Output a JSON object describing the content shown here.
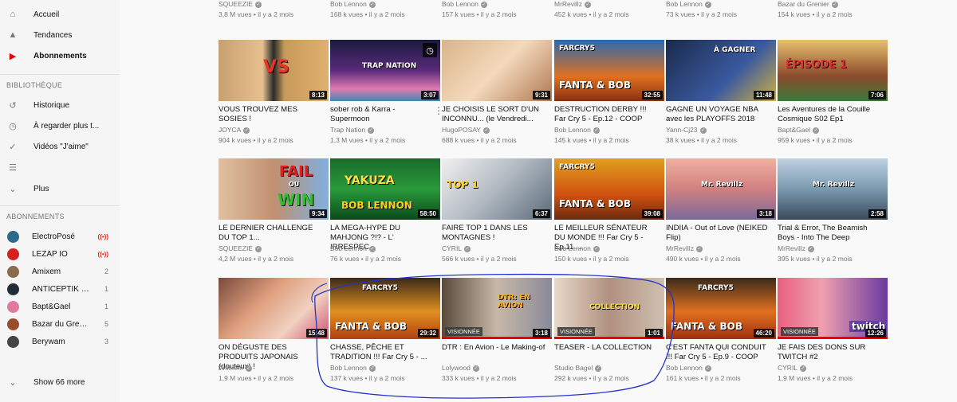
{
  "sidebar": {
    "nav": [
      {
        "label": "Accueil",
        "icon": "home-icon",
        "glyph": "⌂"
      },
      {
        "label": "Tendances",
        "icon": "flame-icon",
        "glyph": "▲"
      },
      {
        "label": "Abonnements",
        "icon": "subscriptions-icon",
        "glyph": "▶",
        "active": true
      }
    ],
    "library_heading": "BIBLIOTHÈQUE",
    "library": [
      {
        "label": "Historique",
        "icon": "history-icon",
        "glyph": "↺"
      },
      {
        "label": "À regarder plus t...",
        "icon": "watch-later-icon",
        "glyph": "◷"
      },
      {
        "label": "Vidéos \"J'aime\"",
        "icon": "thumbs-up-icon",
        "glyph": "✓"
      },
      {
        "label": "",
        "icon": "playlist-icon",
        "glyph": "☰"
      },
      {
        "label": "Plus",
        "icon": "chevron-down-icon",
        "glyph": "⌄"
      }
    ],
    "subs_heading": "ABONNEMENTS",
    "subs": [
      {
        "name": "ElectroPosé",
        "badge": "((•))",
        "live": true,
        "color": "#2b6a8a"
      },
      {
        "name": "LEZAP IO",
        "badge": "((•))",
        "live": true,
        "color": "#d61f1f"
      },
      {
        "name": "Amixem",
        "badge": "2",
        "color": "#8a6b4a"
      },
      {
        "name": "ANTICEPTIK KA...",
        "badge": "1",
        "color": "#222c3a"
      },
      {
        "name": "Bapt&Gael",
        "badge": "1",
        "color": "#e07aa0"
      },
      {
        "name": "Bazar du Grenier",
        "badge": "5",
        "color": "#9a4b2a"
      },
      {
        "name": "Berywam",
        "badge": "3",
        "color": "#444"
      }
    ],
    "show_more": "Show 66 more"
  },
  "top_row": [
    {
      "channel": "SQUEEZIE",
      "meta": "3,8 M vues • il y a 2 mois"
    },
    {
      "channel": "Bob Lennon",
      "meta": "168 k vues • il y a 2 mois"
    },
    {
      "channel": "Bob Lennon",
      "meta": "157 k vues • il y a 2 mois"
    },
    {
      "channel": "MrRevillz",
      "meta": "452 k vues • il y a 2 mois"
    },
    {
      "channel": "Bob Lennon",
      "meta": "73 k vues • il y a 2 mois"
    },
    {
      "channel": "Bazar du Grenier",
      "meta": "154 k vues • il y a 2 mois"
    }
  ],
  "rows": [
    [
      {
        "title": "VOUS TROUVEZ MES SOSIES !",
        "channel": "JOYCA",
        "meta": "904 k vues • il y a 2 mois",
        "duration": "8:13"
      },
      {
        "title": "sober rob & Karra - Supermoon",
        "channel": "Trap Nation",
        "meta": "1,3 M vues • il y a 2 mois",
        "duration": "3:07",
        "menu": true,
        "clock": true
      },
      {
        "title": "JE CHOISIS LE SORT D'UN INCONNU... (le Vendredi...",
        "channel": "HugoPOSAY",
        "meta": "688 k vues • il y a 2 mois",
        "duration": "9:31"
      },
      {
        "title": "DESTRUCTION DERBY !!! Far Cry 5 - Ep.12 - COOP",
        "channel": "Bob Lennon",
        "meta": "145 k vues • il y a 2 mois",
        "duration": "32:55"
      },
      {
        "title": "GAGNE UN VOYAGE NBA avec les PLAYOFFS 2018",
        "channel": "Yann-Cj23",
        "meta": "38 k vues • il y a 2 mois",
        "duration": "11:48"
      },
      {
        "title": "Les Aventures de la Couille Cosmique S02 Ep1",
        "channel": "Bapt&Gael",
        "meta": "959 k vues • il y a 2 mois",
        "duration": "7:06"
      }
    ],
    [
      {
        "title": "LE DERNIER CHALLENGE DU TOP 1...",
        "channel": "SQUEEZIE",
        "meta": "4,2 M vues • il y a 2 mois",
        "duration": "9:34"
      },
      {
        "title": "LA MEGA-HYPE DU MAHJONG ?!? - L' IRRESPEC...",
        "channel": "Bob Lennon",
        "meta": "76 k vues • il y a 2 mois",
        "duration": "58:50"
      },
      {
        "title": "FAIRE TOP 1 DANS LES MONTAGNES !",
        "channel": "CYRIL",
        "meta": "566 k vues • il y a 2 mois",
        "duration": "6:37"
      },
      {
        "title": "LE MEILLEUR SÉNATEUR DU MONDE !!! Far Cry 5 - Ep.11 ...",
        "channel": "Bob Lennon",
        "meta": "150 k vues • il y a 2 mois",
        "duration": "39:08"
      },
      {
        "title": "INDIIA - Out of Love (NEIKED Flip)",
        "channel": "MrRevillz",
        "meta": "490 k vues • il y a 2 mois",
        "duration": "3:18"
      },
      {
        "title": "Trial & Error, The Beamish Boys - Into The Deep",
        "channel": "MrRevillz",
        "meta": "395 k vues • il y a 2 mois",
        "duration": "2:58"
      }
    ],
    [
      {
        "title": "ON DÉGUSTE DES PRODUITS JAPONAIS (douteux) !",
        "channel": "Amixem",
        "meta": "1,9 M vues • il y a 2 mois",
        "duration": "15:48"
      },
      {
        "title": "CHASSE, PÊCHE ET TRADITION !!! Far Cry 5 - ...",
        "channel": "Bob Lennon",
        "meta": "137 k vues • il y a 2 mois",
        "duration": "29:32"
      },
      {
        "title": "DTR : En Avion - Le Making-of",
        "channel": "Lolywood",
        "meta": "333 k vues • il y a 2 mois",
        "duration": "3:18",
        "watched": "VISIONNÉE"
      },
      {
        "title": "TEASER - LA COLLECTION",
        "channel": "Studio Bagel",
        "meta": "292 k vues • il y a 2 mois",
        "duration": "1:01",
        "watched": "VISIONNÉE"
      },
      {
        "title": "C'EST FANTA QUI CONDUIT !!! Far Cry 5 - Ep.9 - COOP",
        "channel": "Bob Lennon",
        "meta": "161 k vues • il y a 2 mois",
        "duration": "46:20"
      },
      {
        "title": "JE FAIS DES DONS SUR TWITCH #2",
        "channel": "CYRIL",
        "meta": "1,9 M vues • il y a 2 mois",
        "duration": "12:26",
        "watched": "VISIONNÉE"
      }
    ]
  ],
  "thumb_text": {
    "vs": "VS",
    "trap": "TRAP NATION",
    "farcry": "FARCRY5",
    "fanta": "FANTA & BOB",
    "fail": "FAIL",
    "ou": "OU",
    "win": "WIN",
    "top1": "TOP 1",
    "yakuza": "YAKUZA",
    "boblennon": "BOB LENNON",
    "episode": "ÉPISODE 1",
    "gagner": "À GAGNER",
    "dtr": "DTR: EN AVION",
    "collection": "COLLECTION",
    "twitch": "twitch",
    "revillz": "Mr. Revillz"
  }
}
